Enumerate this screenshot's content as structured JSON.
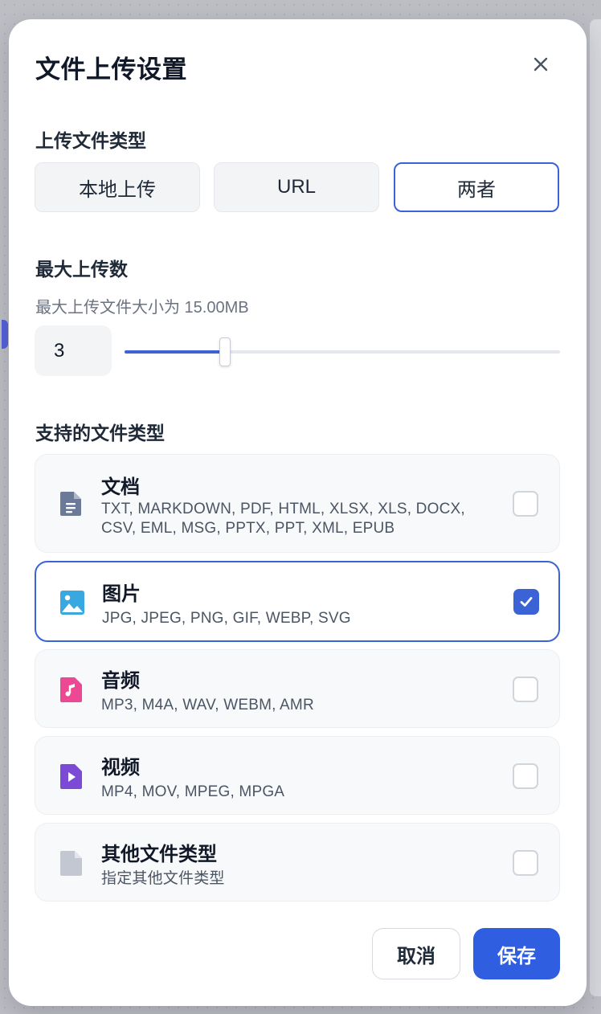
{
  "dialog": {
    "title": "文件上传设置",
    "close_icon": "close-icon"
  },
  "upload_type": {
    "label": "上传文件类型",
    "options": [
      "本地上传",
      "URL",
      "两者"
    ],
    "selected": "两者"
  },
  "max_upload": {
    "label": "最大上传数",
    "hint": "最大上传文件大小为 15.00MB",
    "value": "3",
    "slider_fraction": 0.23
  },
  "file_types": {
    "label": "支持的文件类型",
    "items": [
      {
        "name": "文档",
        "extensions": "TXT, MARKDOWN, PDF, HTML, XLSX, XLS, DOCX, CSV, EML, MSG, PPTX, PPT, XML, EPUB",
        "icon": "document-icon",
        "checked": false,
        "color": "#6b7a99"
      },
      {
        "name": "图片",
        "extensions": "JPG, JPEG, PNG, GIF, WEBP, SVG",
        "icon": "image-icon",
        "checked": true,
        "color": "#3aa8e0"
      },
      {
        "name": "音频",
        "extensions": "MP3, M4A, WAV, WEBM, AMR",
        "icon": "audio-icon",
        "checked": false,
        "color": "#ec4893"
      },
      {
        "name": "视频",
        "extensions": "MP4, MOV, MPEG, MPGA",
        "icon": "video-icon",
        "checked": false,
        "color": "#7c4bd6"
      },
      {
        "name": "其他文件类型",
        "extensions": "指定其他文件类型",
        "icon": "file-icon",
        "checked": false,
        "color": "#c3c7d1"
      }
    ]
  },
  "footer": {
    "cancel_label": "取消",
    "save_label": "保存"
  },
  "colors": {
    "accent": "#3b63d6",
    "primary_button": "#2f5fe0"
  }
}
